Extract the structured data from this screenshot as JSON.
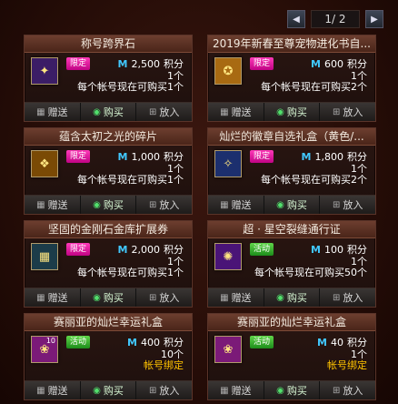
{
  "pager": {
    "prev_icon": "◀",
    "text": "1/ 2",
    "next_icon": "▶"
  },
  "actions": {
    "gift": "赠送",
    "buy": "购买",
    "put": "放入"
  },
  "cards": [
    {
      "title": "称号跨界石",
      "tag": "限定",
      "tag_type": "limited",
      "points": "2,500",
      "points_unit": "积分",
      "qty": "1个",
      "limit": "每个帐号现在可购买1个",
      "thumb_bg": "#3b1d66",
      "thumb_icon": "✦"
    },
    {
      "title": "2019年新春至尊宠物进化书自...",
      "tag": "限定",
      "tag_type": "limited",
      "points": "600",
      "points_unit": "积分",
      "qty": "1个",
      "limit": "每个帐号现在可购买2个",
      "thumb_bg": "#a86a12",
      "thumb_icon": "✪"
    },
    {
      "title": "蕴含太初之光的碎片",
      "tag": "限定",
      "tag_type": "limited",
      "points": "1,000",
      "points_unit": "积分",
      "qty": "1个",
      "limit": "每个帐号现在可购买1个",
      "thumb_bg": "#7a4a05",
      "thumb_icon": "❖"
    },
    {
      "title": "灿烂的徽章自选礼盒（黄色/...",
      "tag": "限定",
      "tag_type": "limited",
      "points": "1,800",
      "points_unit": "积分",
      "qty": "1个",
      "limit": "每个帐号现在可购买2个",
      "thumb_bg": "#1c2f6e",
      "thumb_icon": "✧"
    },
    {
      "title": "坚固的金刚石金库扩展券",
      "tag": "限定",
      "tag_type": "limited",
      "points": "2,000",
      "points_unit": "积分",
      "qty": "1个",
      "limit": "每个帐号现在可购买1个",
      "thumb_bg": "#1c3c49",
      "thumb_icon": "▦"
    },
    {
      "title": "超 · 星空裂缝通行证",
      "tag": "活动",
      "tag_type": "event",
      "points": "100",
      "points_unit": "积分",
      "qty": "1个",
      "limit": "每个帐号现在可购买50个",
      "thumb_bg": "#4a1477",
      "thumb_icon": "✺"
    },
    {
      "title": "赛丽亚的灿烂幸运礼盒",
      "tag": "活动",
      "tag_type": "event",
      "points": "400",
      "points_unit": "积分",
      "qty": "10个",
      "bound": "帐号绑定",
      "thumb_bg": "#7b1a78",
      "thumb_icon": "❀",
      "thumb_count": "10"
    },
    {
      "title": "赛丽亚的灿烂幸运礼盒",
      "tag": "活动",
      "tag_type": "event",
      "points": "40",
      "points_unit": "积分",
      "qty": "1个",
      "bound": "帐号绑定",
      "thumb_bg": "#7b1a78",
      "thumb_icon": "❀"
    }
  ]
}
